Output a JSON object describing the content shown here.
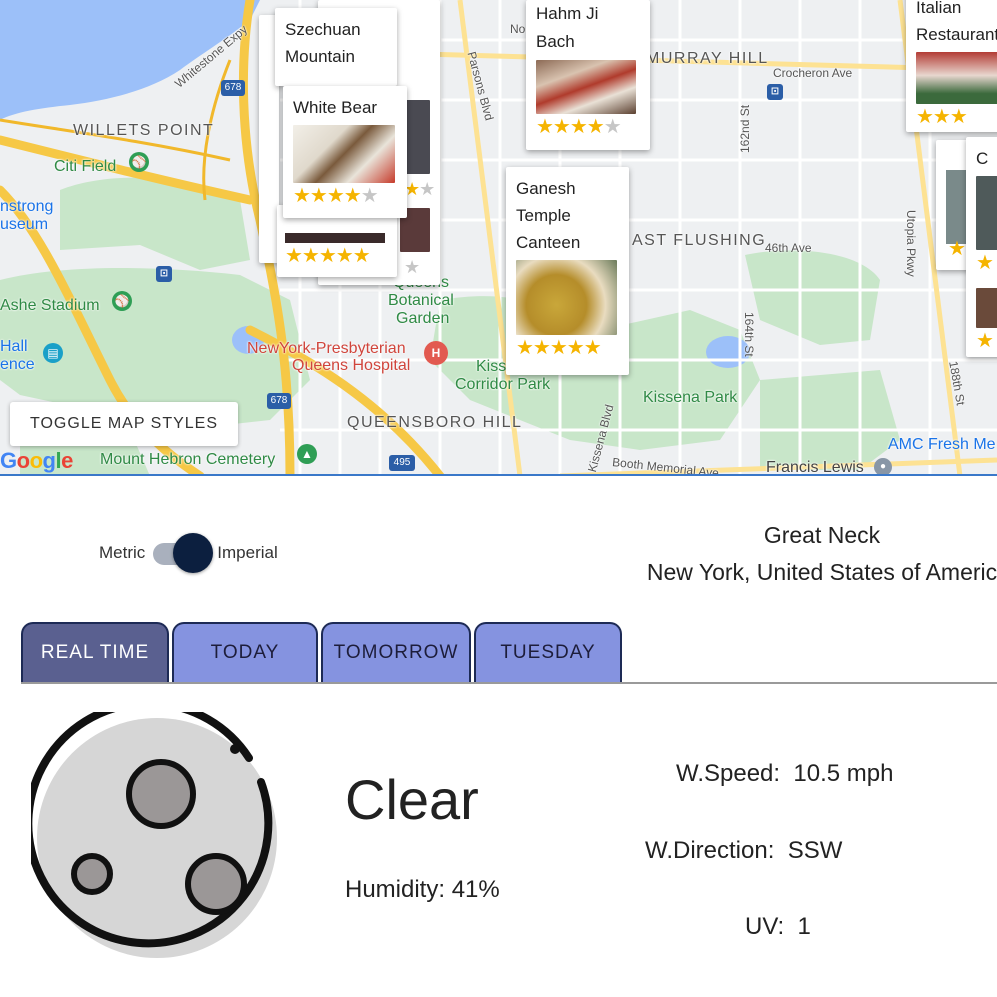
{
  "map": {
    "toggle_button": "TOGGLE MAP STYLES",
    "google_logo": [
      "G",
      "o",
      "o",
      "g",
      "l",
      "e"
    ],
    "neighborhoods": {
      "willets_point": "WILLETS POINT",
      "murray_hill": "MURRAY HILL",
      "east_flushing": "AST FLUSHING",
      "queensboro_hill": "QUEENSBORO HILL"
    },
    "places": {
      "citi_field": "Citi Field",
      "ashe_stadium": "Ashe Stadium",
      "armstrong_1": "nstrong",
      "armstrong_2": "useum",
      "hall_1": "Hall",
      "hall_2": "ence",
      "queens_1": "Queens",
      "queens_2": "Botanical",
      "queens_3": "Garden",
      "hospital_1": "NewYork-Presbyterian",
      "hospital_2": "Queens Hospital",
      "kissena_1": "Kiss",
      "kissena_2": "Corridor Park",
      "kissena_park": "Kissena Park",
      "mount_hebron": "Mount Hebron Cemetery",
      "amc": "AMC Fresh Me",
      "francis_lewis": "Francis Lewis"
    },
    "streets": {
      "whitestone": "Whitestone Expy",
      "parsons": "Parsons Blvd",
      "crocheron": "Crocheron Ave",
      "s162": "162nd St",
      "utopia": "Utopia Pkwy",
      "ave46": "46th Ave",
      "s164": "164th St",
      "s188": "188th St",
      "kissena_blvd": "Kissena Blvd",
      "booth": "Booth Memorial Ave",
      "no": "No"
    },
    "shields": {
      "i678a": "678",
      "i678b": "678",
      "i495": "495"
    },
    "restaurants": [
      {
        "name": "Szechuan Mountain",
        "rating": 4
      },
      {
        "name": "White Bear",
        "rating": 4
      },
      {
        "name": "Hahm Ji Bach",
        "rating": 4
      },
      {
        "name": "Ganesh Temple Canteen",
        "rating": 5
      },
      {
        "name": "Italian Restaurant",
        "rating": 3
      },
      {
        "name": "C",
        "rating": 4
      }
    ]
  },
  "units": {
    "metric_label": "Metric",
    "imperial_label": "Imperial",
    "selected": "imperial"
  },
  "location": {
    "city": "Great Neck",
    "region": "New York, United States of Americ"
  },
  "tabs": [
    {
      "label": "REAL TIME",
      "active": true
    },
    {
      "label": "TODAY",
      "active": false
    },
    {
      "label": "TOMORROW",
      "active": false
    },
    {
      "label": "TUESDAY",
      "active": false
    }
  ],
  "current": {
    "icon": "moon-icon",
    "condition": "Clear",
    "humidity": "Humidity: 41%",
    "wind_speed_label": "W.Speed:",
    "wind_speed_value": "10.5 mph",
    "wind_direction_label": "W.Direction:",
    "wind_direction_value": "SSW",
    "uv_label": "UV:",
    "uv_value": "1"
  },
  "colors": {
    "tab_active": "#5a6090",
    "tab_inactive": "#8593e0",
    "star": "#f5b400",
    "toggle_knob": "#0c1f3f",
    "map_highway": "#f6c846",
    "map_water": "#9cc0f9",
    "map_park": "#c8e6c9"
  }
}
